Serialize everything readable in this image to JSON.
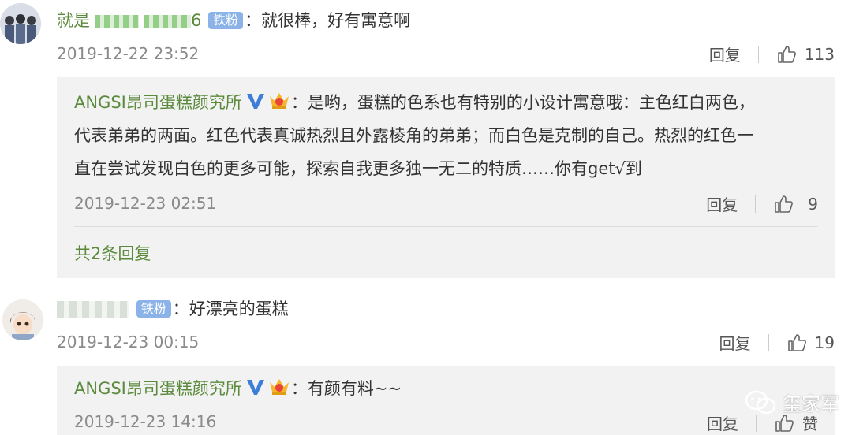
{
  "comment1": {
    "username_prefix": "就是",
    "username_suffix": "6",
    "badge": "铁粉",
    "text": "：就很棒，好有寓意啊",
    "time": "2019-12-22 23:52",
    "reply_label": "回复",
    "like_count": "113"
  },
  "reply1": {
    "name": "ANGSI昂司蛋糕颜究所",
    "text_line1": "：是哟，蛋糕的色系也有特别的小设计寓意哦：主色红白两色，",
    "text_line2": "代表弟弟的两面。红色代表真诚热烈且外露棱角的弟弟；而白色是克制的自己。热烈的红色一",
    "text_line3": "直在尝试发现白色的更多可能，探索自我更多独一无二的特质……你有get√到",
    "time": "2019-12-23 02:51",
    "reply_label": "回复",
    "like_count": "9",
    "more_replies": "共2条回复"
  },
  "comment2": {
    "badge": "铁粉",
    "text": "：好漂亮的蛋糕",
    "time": "2019-12-23 00:15",
    "reply_label": "回复",
    "like_count": "19"
  },
  "reply2": {
    "name": "ANGSI昂司蛋糕颜究所",
    "text": "：有颜有料~~",
    "time": "2019-12-23 14:16",
    "reply_label": "回复",
    "like_label": "赞"
  },
  "watermark": {
    "text": "玺家军"
  },
  "colors": {
    "username": "#5b8a3c",
    "badge": "#8bb3e8",
    "reply_bg": "#f2f2f2"
  },
  "icons": [
    "thumbs-up-icon",
    "verified-v-icon",
    "crown-icon",
    "wechat-icon"
  ]
}
